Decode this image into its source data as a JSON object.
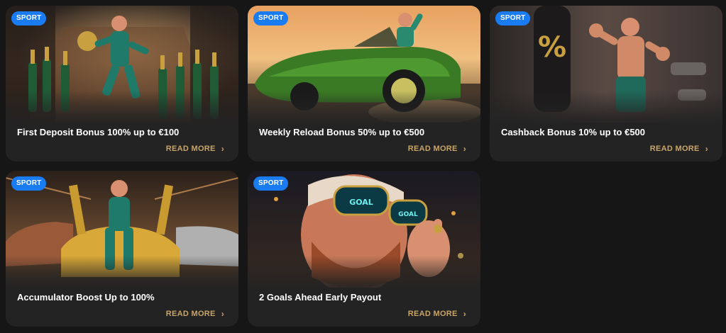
{
  "colors": {
    "page_background": "#161616",
    "card_background": "#232323",
    "badge_background": "#1a7cf2",
    "read_more": "#c9a467"
  },
  "cards": [
    {
      "badge": "SPORT",
      "title": "First Deposit Bonus 100% up to €100",
      "read_more": "READ MORE",
      "chevron": "›",
      "icon": "chevron-right-icon"
    },
    {
      "badge": "SPORT",
      "title": "Weekly Reload Bonus 50% up to €500",
      "read_more": "READ MORE",
      "chevron": "›",
      "icon": "chevron-right-icon"
    },
    {
      "badge": "SPORT",
      "title": "Cashback Bonus 10% up to €500",
      "read_more": "READ MORE",
      "chevron": "›",
      "icon": "chevron-right-icon"
    },
    {
      "badge": "SPORT",
      "title": "Accumulator Boost Up to 100%",
      "read_more": "READ MORE",
      "chevron": "›",
      "icon": "chevron-right-icon"
    },
    {
      "badge": "SPORT",
      "title": "2 Goals Ahead Early Payout",
      "read_more": "READ MORE",
      "chevron": "›",
      "icon": "chevron-right-icon"
    }
  ],
  "art": {
    "card_3_sign": "%",
    "card_5_glasses_left": "GOAL",
    "card_5_glasses_right": "GOAL"
  }
}
